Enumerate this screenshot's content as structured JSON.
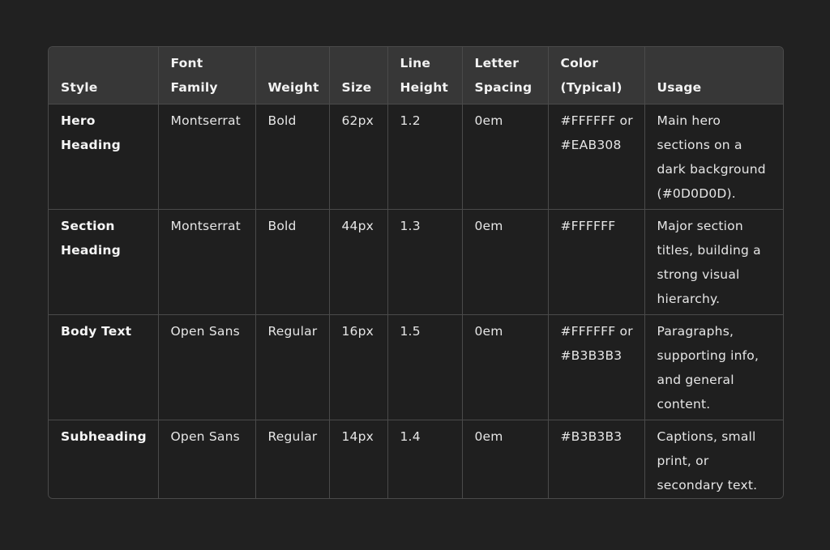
{
  "table": {
    "headers": [
      "Style",
      "Font Family",
      "Weight",
      "Size",
      "Line Height",
      "Letter Spacing",
      "Color (Typical)",
      "Usage"
    ],
    "rows": [
      {
        "style": "Hero Heading",
        "font_family": "Montserrat",
        "weight": "Bold",
        "size": "62px",
        "line_height": "1.2",
        "letter_spacing": "0em",
        "color": "#FFFFFF or #EAB308",
        "usage": "Main hero sections on a dark background (#0D0D0D)."
      },
      {
        "style": "Section Heading",
        "font_family": "Montserrat",
        "weight": "Bold",
        "size": "44px",
        "line_height": "1.3",
        "letter_spacing": "0em",
        "color": "#FFFFFF",
        "usage": "Major section titles, building a strong visual hierarchy."
      },
      {
        "style": "Body Text",
        "font_family": "Open Sans",
        "weight": "Regular",
        "size": "16px",
        "line_height": "1.5",
        "letter_spacing": "0em",
        "color": "#FFFFFF or #B3B3B3",
        "usage": "Paragraphs, supporting info, and general content."
      },
      {
        "style": "Subheading",
        "font_family": "Open Sans",
        "weight": "Regular",
        "size": "14px",
        "line_height": "1.4",
        "letter_spacing": "0em",
        "color": "#B3B3B3",
        "usage": "Captions, small print, or secondary text."
      }
    ]
  },
  "colors": {
    "page_background": "#212121",
    "header_background": "#373737",
    "body_background": "#1f1f1f",
    "border": "#4a4a4a",
    "text": "#ececec"
  }
}
